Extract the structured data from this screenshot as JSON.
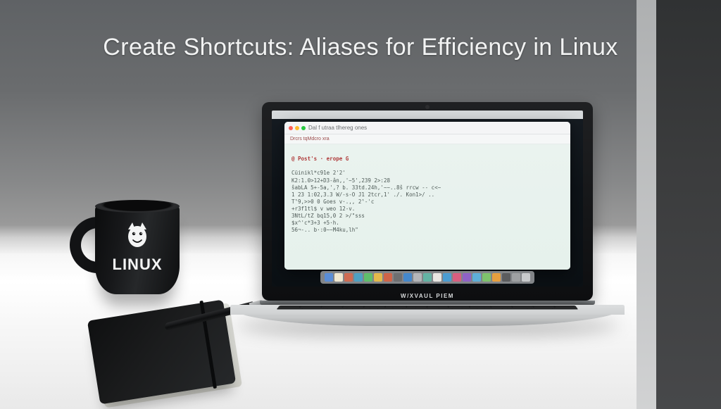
{
  "title": "Create Shortcuts: Aliases for Efficiency in Linux",
  "mug": {
    "text": "LINUX",
    "icon": "tux-icon"
  },
  "laptop": {
    "brand": "W/XVAUL PIEM",
    "terminal": {
      "window_title": "Dal f utraa tlhereg ones",
      "subheader": "Drcrs tqMdcro xra",
      "prompt": "@ Post's · erope G",
      "lines": [
        "Cüinikl*c91e 2'2'",
        "K2:1.0>12+D3-ân,,'~5',239  2>:28",
        "ŝabLA   5+-5a,',? b. 33td.24h,'~~..8ŝ rrcw -- c<~",
        "1 23 1:02,3.3   W/-s-O J1 2tcr,1' ./. Kon1>/ ..",
        "T‛9,>>0 0 Goes v·.,, 2‛-'c",
        "+r3f1tl$ v weo 12-v.",
        "3NtL/tZ bq15,0 2 >/\"sss",
        "$x^'c*3+3 +5·h.",
        "56¬-.. b·:0~~M4ku,lh\""
      ]
    },
    "dock_colors": [
      "#5a8dd6",
      "#efe7d0",
      "#cf6b52",
      "#4da1c4",
      "#5fbf6b",
      "#e4b94b",
      "#d06448",
      "#6e6f71",
      "#4488cc",
      "#b4b6b9",
      "#63b3a4",
      "#e8e6e2",
      "#4b9dd2",
      "#d85e7f",
      "#8f62c6",
      "#5eb0d8",
      "#7ec26c",
      "#e79f3f",
      "#5b5c5e",
      "#9ea0a2",
      "#c8cacc"
    ]
  }
}
